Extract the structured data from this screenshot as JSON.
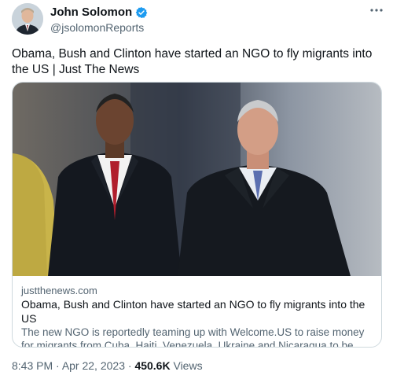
{
  "author": {
    "display_name": "John Solomon",
    "handle": "@jsolomonReports",
    "verified": true
  },
  "tweet": {
    "text": "Obama, Bush and Clinton have started an NGO to fly migrants into the US  | Just The News"
  },
  "card": {
    "domain": "justthenews.com",
    "title": "Obama, Bush and Clinton have started an NGO to fly migrants into the US",
    "description": "The new NGO is reportedly teaming up with Welcome.US to raise money for migrants from Cuba, Haiti, Venezuela, Ukraine and Nicaragua to be flown into..."
  },
  "footer": {
    "time": "8:43 PM",
    "sep1": " · ",
    "date": "Apr 22, 2023",
    "sep2": " · ",
    "views_count": "450.6K",
    "views_label": " Views"
  },
  "icons": {
    "verified": "verified-badge-icon",
    "more": "more-horizontal-icon"
  },
  "colors": {
    "verified_blue": "#1d9bf0",
    "secondary_text": "#536471",
    "primary_text": "#0f1419",
    "border": "#cfd9de"
  }
}
